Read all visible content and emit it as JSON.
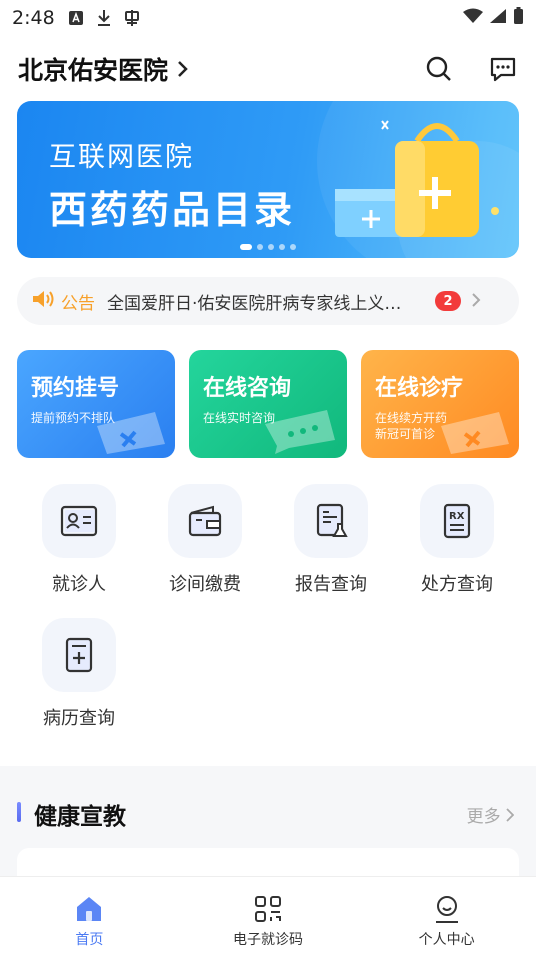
{
  "status_bar": {
    "time": "2:48"
  },
  "header": {
    "hospital_name": "北京佑安医院"
  },
  "banner": {
    "line1": "互联网医院",
    "line2": "西药药品目录"
  },
  "notice": {
    "tag": "公告",
    "text": "全国爱肝日·佑安医院肝病专家线上义…",
    "badge": "2"
  },
  "service_cards": [
    {
      "title": "预约挂号",
      "subtitle": "提前预约不排队",
      "color": "#3a93f8"
    },
    {
      "title": "在线咨询",
      "subtitle": "在线实时咨询",
      "color": "#1cc78e"
    },
    {
      "title": "在线诊疗",
      "subtitle": "在线续方开药",
      "subtitle2": "新冠可首诊",
      "color": "#ff9b30"
    }
  ],
  "grid_items": [
    {
      "label": "就诊人",
      "icon": "id-card-icon"
    },
    {
      "label": "诊间缴费",
      "icon": "wallet-icon"
    },
    {
      "label": "报告查询",
      "icon": "report-icon"
    },
    {
      "label": "处方查询",
      "icon": "rx-icon"
    },
    {
      "label": "病历查询",
      "icon": "medical-record-icon"
    }
  ],
  "health_section": {
    "title": "健康宣教",
    "more": "更多"
  },
  "tabbar": [
    {
      "label": "首页",
      "icon": "home-icon",
      "active": true
    },
    {
      "label": "电子就诊码",
      "icon": "qr-code-icon",
      "active": false
    },
    {
      "label": "个人中心",
      "icon": "user-icon",
      "active": false
    }
  ],
  "colors": {
    "accent": "#4c7bf3",
    "notice_orange": "#f7a12b",
    "badge_red": "#f23b3b"
  }
}
